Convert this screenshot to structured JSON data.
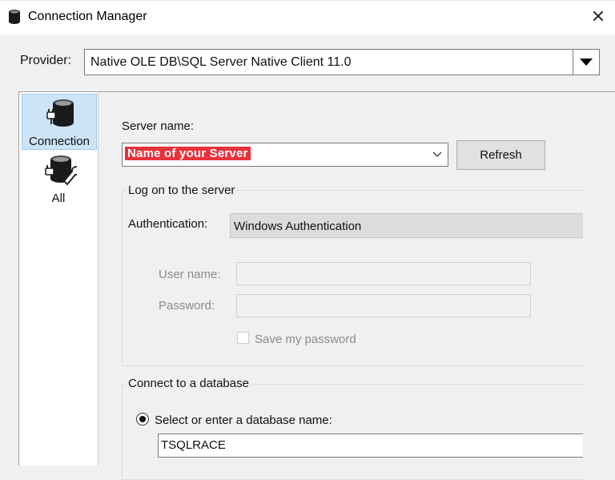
{
  "window": {
    "title": "Connection Manager",
    "close_glyph": "✕"
  },
  "provider": {
    "label": "Provider:",
    "value": "Native OLE DB\\SQL Server Native Client 11.0"
  },
  "sidebar": {
    "items": [
      {
        "label": "Connection",
        "icon": "database-plug-icon",
        "selected": true
      },
      {
        "label": "All",
        "icon": "database-wrench-icon",
        "selected": false
      }
    ]
  },
  "server": {
    "label": "Server name:",
    "value": "Name of your Server",
    "refresh_label": "Refresh"
  },
  "logon": {
    "title": "Log on to the server",
    "auth_label": "Authentication:",
    "auth_value": "Windows Authentication",
    "user_label": "User name:",
    "user_value": "",
    "password_label": "Password:",
    "password_value": "",
    "save_password_label": "Save my password",
    "save_password_checked": false
  },
  "database": {
    "title": "Connect to a database",
    "radio_label": "Select or enter a database name:",
    "radio_selected": true,
    "db_value": "TSQLRACE"
  },
  "colors": {
    "selected_nav_bg": "#cce4f7",
    "highlight_red": "#e8323c",
    "window_bg": "#f0f0f0"
  }
}
